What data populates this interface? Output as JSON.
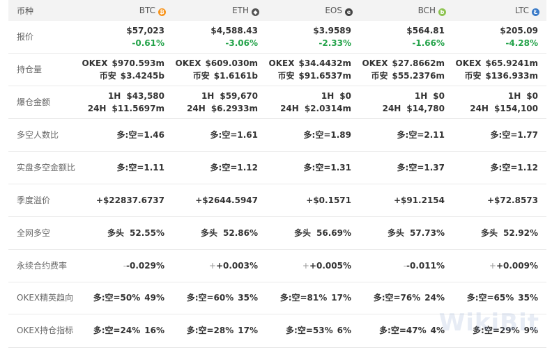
{
  "header": {
    "label": "币种",
    "coins": [
      {
        "name": "BTC",
        "icon": "btc-icon",
        "color": "#f7931a"
      },
      {
        "name": "ETH",
        "icon": "eth-icon",
        "color": "#555555"
      },
      {
        "name": "EOS",
        "icon": "eos-icon",
        "color": "#444444"
      },
      {
        "name": "BCH",
        "icon": "bch-icon",
        "color": "#8dc351"
      },
      {
        "name": "LTC",
        "icon": "ltc-icon",
        "color": "#3b7bc8"
      }
    ]
  },
  "rows": {
    "price": {
      "label": "报价",
      "cells": [
        {
          "price": "$57,023",
          "change": "-0.61%"
        },
        {
          "price": "$4,588.43",
          "change": "-3.06%"
        },
        {
          "price": "$3.9589",
          "change": "-2.33%"
        },
        {
          "price": "$564.81",
          "change": "-1.66%"
        },
        {
          "price": "$205.09",
          "change": "-4.28%"
        }
      ]
    },
    "oi": {
      "label": "持仓量",
      "cells": [
        {
          "okex_label": "OKEX",
          "okex": "$970.593m",
          "bn_label": "币安",
          "bn": "$3.4245b"
        },
        {
          "okex_label": "OKEX",
          "okex": "$609.030m",
          "bn_label": "币安",
          "bn": "$1.6161b"
        },
        {
          "okex_label": "OKEX",
          "okex": "$34.4432m",
          "bn_label": "币安",
          "bn": "$91.6537m"
        },
        {
          "okex_label": "OKEX",
          "okex": "$27.8662m",
          "bn_label": "币安",
          "bn": "$55.2376m"
        },
        {
          "okex_label": "OKEX",
          "okex": "$65.9241m",
          "bn_label": "币安",
          "bn": "$136.933m"
        }
      ]
    },
    "liq": {
      "label": "爆仓金额",
      "cells": [
        {
          "h1_label": "1H",
          "h1": "$43,580",
          "h24_label": "24H",
          "h24": "$11.5697m"
        },
        {
          "h1_label": "1H",
          "h1": "$59,670",
          "h24_label": "24H",
          "h24": "$6.2933m"
        },
        {
          "h1_label": "1H",
          "h1": "$0",
          "h24_label": "24H",
          "h24": "$2.0314m"
        },
        {
          "h1_label": "1H",
          "h1": "$0",
          "h24_label": "24H",
          "h24": "$14,780"
        },
        {
          "h1_label": "1H",
          "h1": "$0",
          "h24_label": "24H",
          "h24": "$154,100"
        }
      ]
    },
    "ls_people": {
      "label": "多空人数比",
      "cells": [
        "多:空=1.46",
        "多:空=1.61",
        "多:空=1.89",
        "多:空=2.11",
        "多:空=1.77"
      ]
    },
    "ls_amount": {
      "label": "实盘多空金额比",
      "cells": [
        "多:空=1.11",
        "多:空=1.12",
        "多:空=1.31",
        "多:空=1.37",
        "多:空=1.12"
      ]
    },
    "premium": {
      "label": "季度溢价",
      "cells": [
        "+$22837.6737",
        "+$2644.5947",
        "+$0.1571",
        "+$91.2154",
        "+$72.8573"
      ]
    },
    "net_ls": {
      "label": "全网多空",
      "cells": [
        {
          "tag": "多头",
          "pct": "52.55%"
        },
        {
          "tag": "多头",
          "pct": "52.86%"
        },
        {
          "tag": "多头",
          "pct": "56.69%"
        },
        {
          "tag": "多头",
          "pct": "57.73%"
        },
        {
          "tag": "多头",
          "pct": "52.92%"
        }
      ]
    },
    "funding": {
      "label": "永续合约费率",
      "cells": [
        {
          "sign": "-",
          "value": "-0.029%"
        },
        {
          "sign": "+",
          "value": "+0.003%"
        },
        {
          "sign": "+",
          "value": "+0.005%"
        },
        {
          "sign": "-",
          "value": "-0.011%"
        },
        {
          "sign": "+",
          "value": "+0.009%"
        }
      ]
    },
    "elite": {
      "label": "OKEX精英趋向",
      "cells": [
        {
          "ratio": "多:空=50%",
          "pct": "49%"
        },
        {
          "ratio": "多:空=60%",
          "pct": "35%"
        },
        {
          "ratio": "多:空=81%",
          "pct": "17%"
        },
        {
          "ratio": "多:空=76%",
          "pct": "24%"
        },
        {
          "ratio": "多:空=65%",
          "pct": "35%"
        }
      ]
    },
    "oi_index": {
      "label": "OKEX持仓指标",
      "cells": [
        {
          "ratio": "多:空=24%",
          "pct": "16%"
        },
        {
          "ratio": "多:空=28%",
          "pct": "17%"
        },
        {
          "ratio": "多:空=53%",
          "pct": "6%"
        },
        {
          "ratio": "多:空=47%",
          "pct": "4%"
        },
        {
          "ratio": "多:空=29%",
          "pct": "9%"
        }
      ]
    }
  },
  "watermark": "WikiBit"
}
